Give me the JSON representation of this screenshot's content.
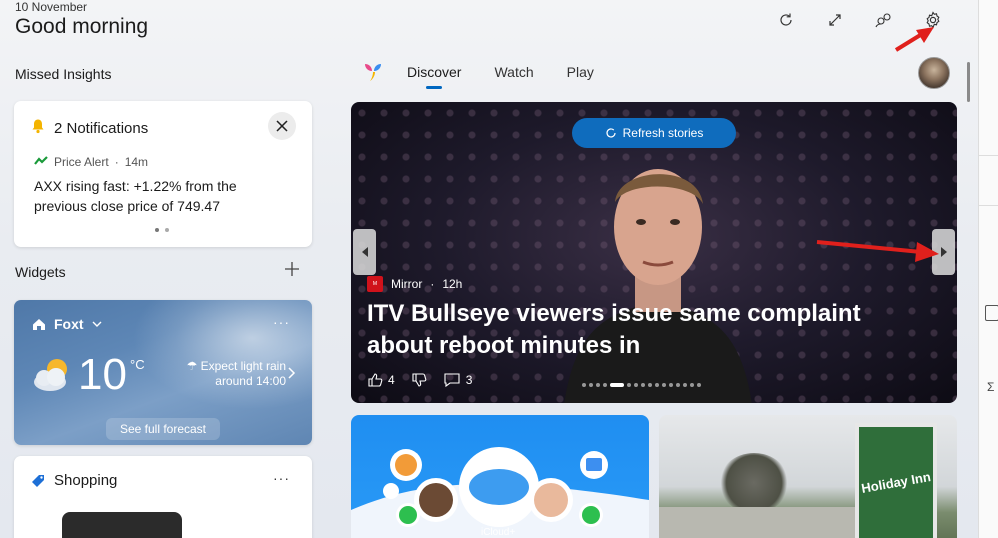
{
  "header": {
    "date": "10 November",
    "greeting": "Good morning"
  },
  "top_actions": [
    "refresh-icon",
    "expand-icon",
    "people-icon",
    "settings-icon"
  ],
  "left": {
    "missed_insights_title": "Missed Insights",
    "notifications": {
      "title": "2 Notifications",
      "source": "Price Alert",
      "age": "14m",
      "message": "AXX rising fast: +1.22% from the previous close price of 749.47",
      "page_count": 2
    },
    "widgets_title": "Widgets",
    "weather": {
      "location": "Foxt",
      "temperature": "10",
      "unit": "°C",
      "forecast": "Expect light rain around 14:00",
      "link": "See full forecast"
    },
    "shopping": {
      "title": "Shopping"
    }
  },
  "feed": {
    "tabs": [
      {
        "label": "Discover",
        "active": true
      },
      {
        "label": "Watch",
        "active": false
      },
      {
        "label": "Play",
        "active": false
      }
    ],
    "hero": {
      "refresh_label": "Refresh stories",
      "source": "Mirror",
      "age": "12h",
      "headline": "ITV Bullseye viewers issue same complaint about reboot minutes in",
      "likes": "4",
      "comments": "3",
      "pager_total": 16,
      "pager_active": 4
    },
    "card2_label": "iCloud+",
    "card3_sign": "Holiday Inn"
  },
  "colors": {
    "accent": "#0f6cbd",
    "annotation_arrow": "#e0201c"
  }
}
